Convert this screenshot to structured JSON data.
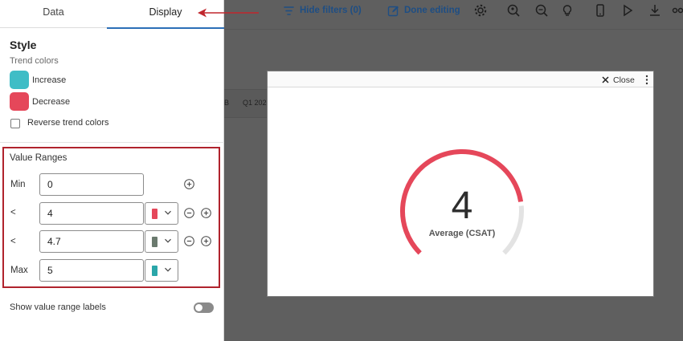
{
  "tabs": {
    "data": "Data",
    "display": "Display"
  },
  "style": {
    "heading": "Style",
    "trend_colors_label": "Trend colors",
    "increase_label": "Increase",
    "decrease_label": "Decrease",
    "increase_color": "#3fbdc6",
    "decrease_color": "#e5475a",
    "reverse_label": "Reverse trend colors",
    "reverse_checked": false
  },
  "value_ranges": {
    "heading": "Value Ranges",
    "rows": [
      {
        "label": "Min",
        "value": "0",
        "color": null
      },
      {
        "label": "<",
        "value": "4",
        "color": "#e5475a"
      },
      {
        "label": "<",
        "value": "4.7",
        "color": "#6b7a6e"
      },
      {
        "label": "Max",
        "value": "5",
        "color": "#2aa6a9"
      }
    ]
  },
  "show_labels": {
    "label": "Show value range labels",
    "on": false
  },
  "toolbar": {
    "hide_filters": "Hide filters (0)",
    "done_editing": "Done editing",
    "icons": [
      "gear-icon",
      "search-user-icon",
      "zoom-icon",
      "bulb-icon",
      "mobile-icon",
      "play-icon",
      "download-icon",
      "share-icon"
    ]
  },
  "background": {
    "tick_b": "B",
    "tick_q1": "Q1 202"
  },
  "modal": {
    "close": "Close",
    "value": "4",
    "label": "Average (CSAT)",
    "min": 0,
    "max": 5,
    "fill_color": "#e5475a",
    "track_color": "#e3e3e3"
  }
}
